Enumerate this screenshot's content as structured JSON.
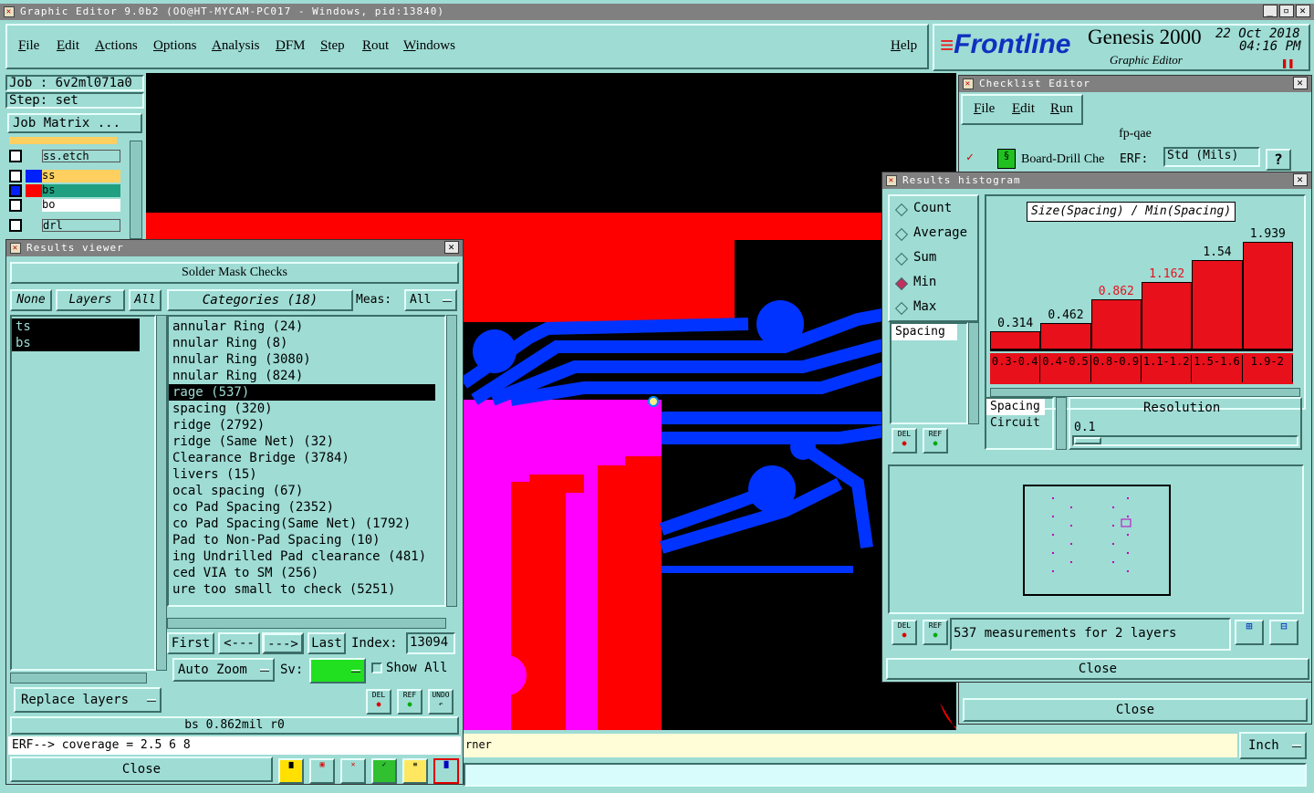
{
  "window": {
    "title": "Graphic Editor 9.0b2 (OO@HT-MYCAM-PC017 - Windows, pid:13840)"
  },
  "menu": [
    "File",
    "Edit",
    "Actions",
    "Options",
    "Analysis",
    "DFM",
    "Step",
    "Rout",
    "Windows"
  ],
  "menu_help": "Help",
  "brand": {
    "logo": "Frontline",
    "product": "Genesis 2000",
    "subtitle": "Graphic Editor",
    "date": "22 Oct 2018",
    "time": "04:16 PM"
  },
  "job": {
    "job_label": "Job  :  6v2ml071a0",
    "step_label": "Step: set",
    "job_matrix": "Job Matrix ..."
  },
  "layers_panel": [
    "ss.etch",
    "ss",
    "bs",
    "bo",
    "drl"
  ],
  "results_viewer": {
    "title": "Results viewer",
    "header": "Solder Mask Checks",
    "none": "None",
    "layers_btn": "Layers",
    "all": "All",
    "categories_btn": "Categories (18)",
    "meas_label": "Meas:",
    "meas_value": "All",
    "layers": [
      "ts",
      "bs"
    ],
    "categories": [
      "annular Ring (24)",
      "nnular Ring (8)",
      "nnular Ring (3080)",
      "nnular Ring (824)",
      "rage (537)",
      "spacing (320)",
      "ridge (2792)",
      "ridge (Same Net) (32)",
      "Clearance Bridge (3784)",
      "livers (15)",
      "ocal spacing (67)",
      "co Pad Spacing (2352)",
      "co Pad Spacing(Same Net) (1792)",
      "Pad to Non-Pad Spacing (10)",
      "ing Undrilled Pad clearance (481)",
      "ced VIA to SM (256)",
      "ure too small to check (5251)"
    ],
    "selected_index": 4,
    "nav": {
      "first": "First",
      "prev": "<---",
      "next": "--->",
      "last": "Last",
      "index_label": "Index:",
      "index_value": "13094"
    },
    "auto_zoom": "Auto Zoom",
    "sv_label": "Sv:",
    "show_all": "Show All",
    "replace_layers": "Replace layers",
    "status": "bs 0.862mil   r0",
    "erf_line": "ERF--> coverage = 2.5 6 8",
    "close": "Close",
    "del": "DEL",
    "ref": "REF",
    "undo": "UNDO"
  },
  "message_bar": {
    "text": "rner",
    "units": "Inch"
  },
  "checklist": {
    "title": "Checklist Editor",
    "menu": [
      "File",
      "Edit",
      "Run"
    ],
    "name": "fp-qae",
    "row": "Board-Drill Che",
    "erf": "ERF:",
    "erf_value": "Std (Mils)",
    "close": "Close"
  },
  "histogram": {
    "title": "Results histogram",
    "modes": [
      "Count",
      "Average",
      "Sum",
      "Min",
      "Max"
    ],
    "selected_mode": "Min",
    "chart_title": "Size(Spacing) / Min(Spacing)",
    "list_items": [
      "Spacing"
    ],
    "list2": [
      "Spacing",
      "Circuit"
    ],
    "resolution_label": "Resolution",
    "resolution_value": "0.1",
    "measurements": "537 measurements for 2 layers",
    "close": "Close"
  },
  "chart_data": {
    "type": "bar",
    "title": "Size(Spacing) / Min(Spacing)",
    "categories": [
      "0.3-0.4",
      "0.4-0.5",
      "0.8-0.9",
      "1.1-1.2",
      "1.5-1.6",
      "1.9-2"
    ],
    "values": [
      0.314,
      0.462,
      0.862,
      1.162,
      1.54,
      1.939
    ],
    "value_labels": [
      "0.314",
      "0.462",
      "0.862",
      "1.162",
      "1.54",
      "1.939"
    ],
    "ylim": [
      0,
      2.2
    ],
    "highlight_labels": [
      2,
      3
    ],
    "bar_color": "#e8101a"
  },
  "colors": {
    "bg": "#9edcd4",
    "red": "#ff0000",
    "magenta": "#ff00ff",
    "blue": "#0033ff"
  }
}
